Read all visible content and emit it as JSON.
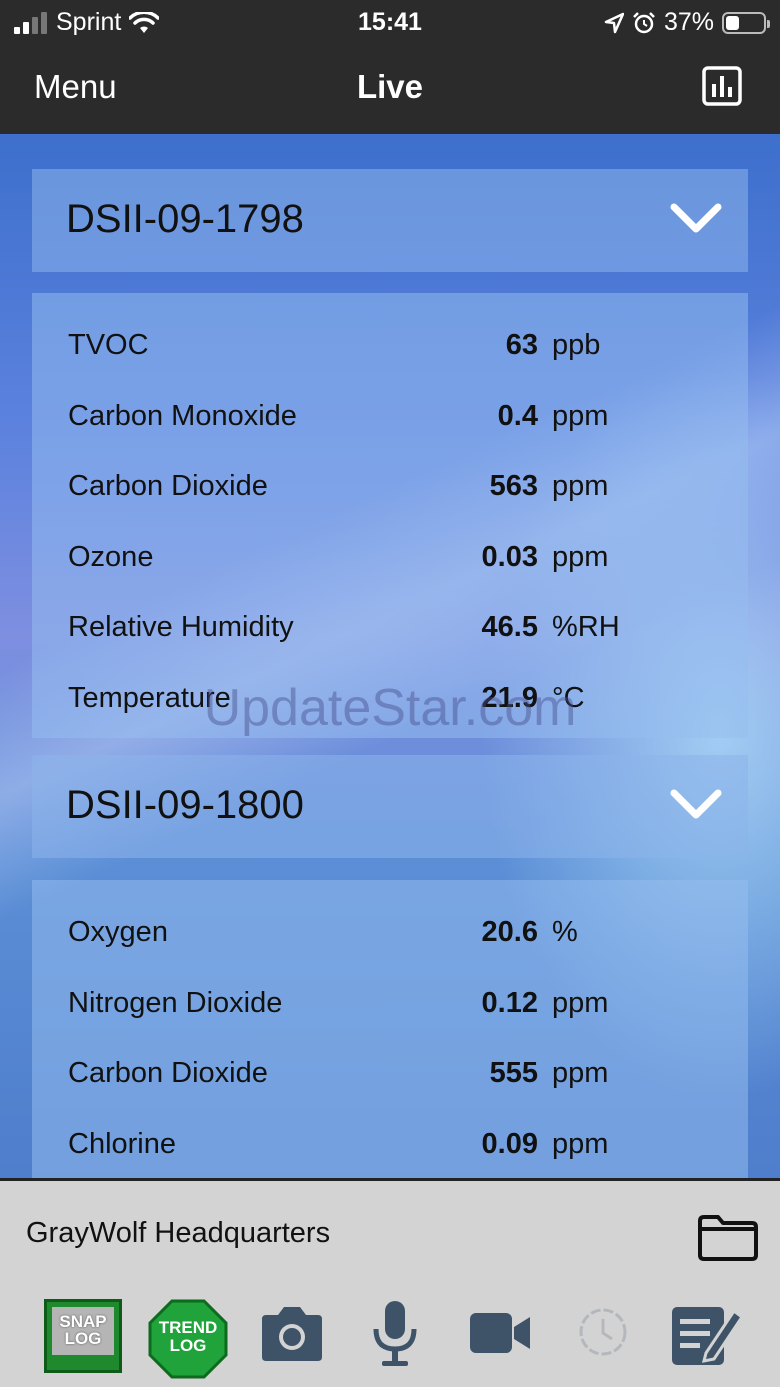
{
  "status_bar": {
    "carrier": "Sprint",
    "time": "15:41",
    "battery": "37%",
    "battery_level": 0.37,
    "icons": [
      "signal-bars-icon",
      "wifi-icon",
      "location-arrow-icon",
      "alarm-icon",
      "battery-icon"
    ]
  },
  "nav": {
    "menu_label": "Menu",
    "title": "Live",
    "chart_icon": "bar-chart-icon"
  },
  "devices": [
    {
      "name": "DSII-09-1798",
      "readings": [
        {
          "label": "TVOC",
          "value": "63",
          "unit": "ppb"
        },
        {
          "label": "Carbon Monoxide",
          "value": "0.4",
          "unit": "ppm"
        },
        {
          "label": "Carbon Dioxide",
          "value": "563",
          "unit": "ppm"
        },
        {
          "label": "Ozone",
          "value": "0.03",
          "unit": "ppm"
        },
        {
          "label": "Relative Humidity",
          "value": "46.5",
          "unit": "%RH"
        },
        {
          "label": "Temperature",
          "value": "21.9",
          "unit": "°C"
        }
      ]
    },
    {
      "name": "DSII-09-1800",
      "readings": [
        {
          "label": "Oxygen",
          "value": "20.6",
          "unit": "%"
        },
        {
          "label": "Nitrogen Dioxide",
          "value": "0.12",
          "unit": "ppm"
        },
        {
          "label": "Carbon Dioxide",
          "value": "555",
          "unit": "ppm"
        },
        {
          "label": "Chlorine",
          "value": "0.09",
          "unit": "ppm"
        }
      ]
    }
  ],
  "watermark": "UpdateStar.com",
  "footer": {
    "location": "GrayWolf Headquarters",
    "folder_icon": "folder-icon",
    "tools": {
      "snap_log": {
        "line1": "SNAP",
        "line2": "LOG"
      },
      "trend_log": {
        "line1": "TREND",
        "line2": "LOG"
      },
      "icons": [
        "camera-icon",
        "microphone-icon",
        "video-camera-icon",
        "history-clock-icon",
        "notes-edit-icon"
      ]
    }
  },
  "colors": {
    "bar": "#2b2b2b",
    "footer": "#d3d3d3",
    "snap_green": "#1f8a2d",
    "trend_green": "#1fa33a",
    "tool_icon": "#3e5368"
  }
}
